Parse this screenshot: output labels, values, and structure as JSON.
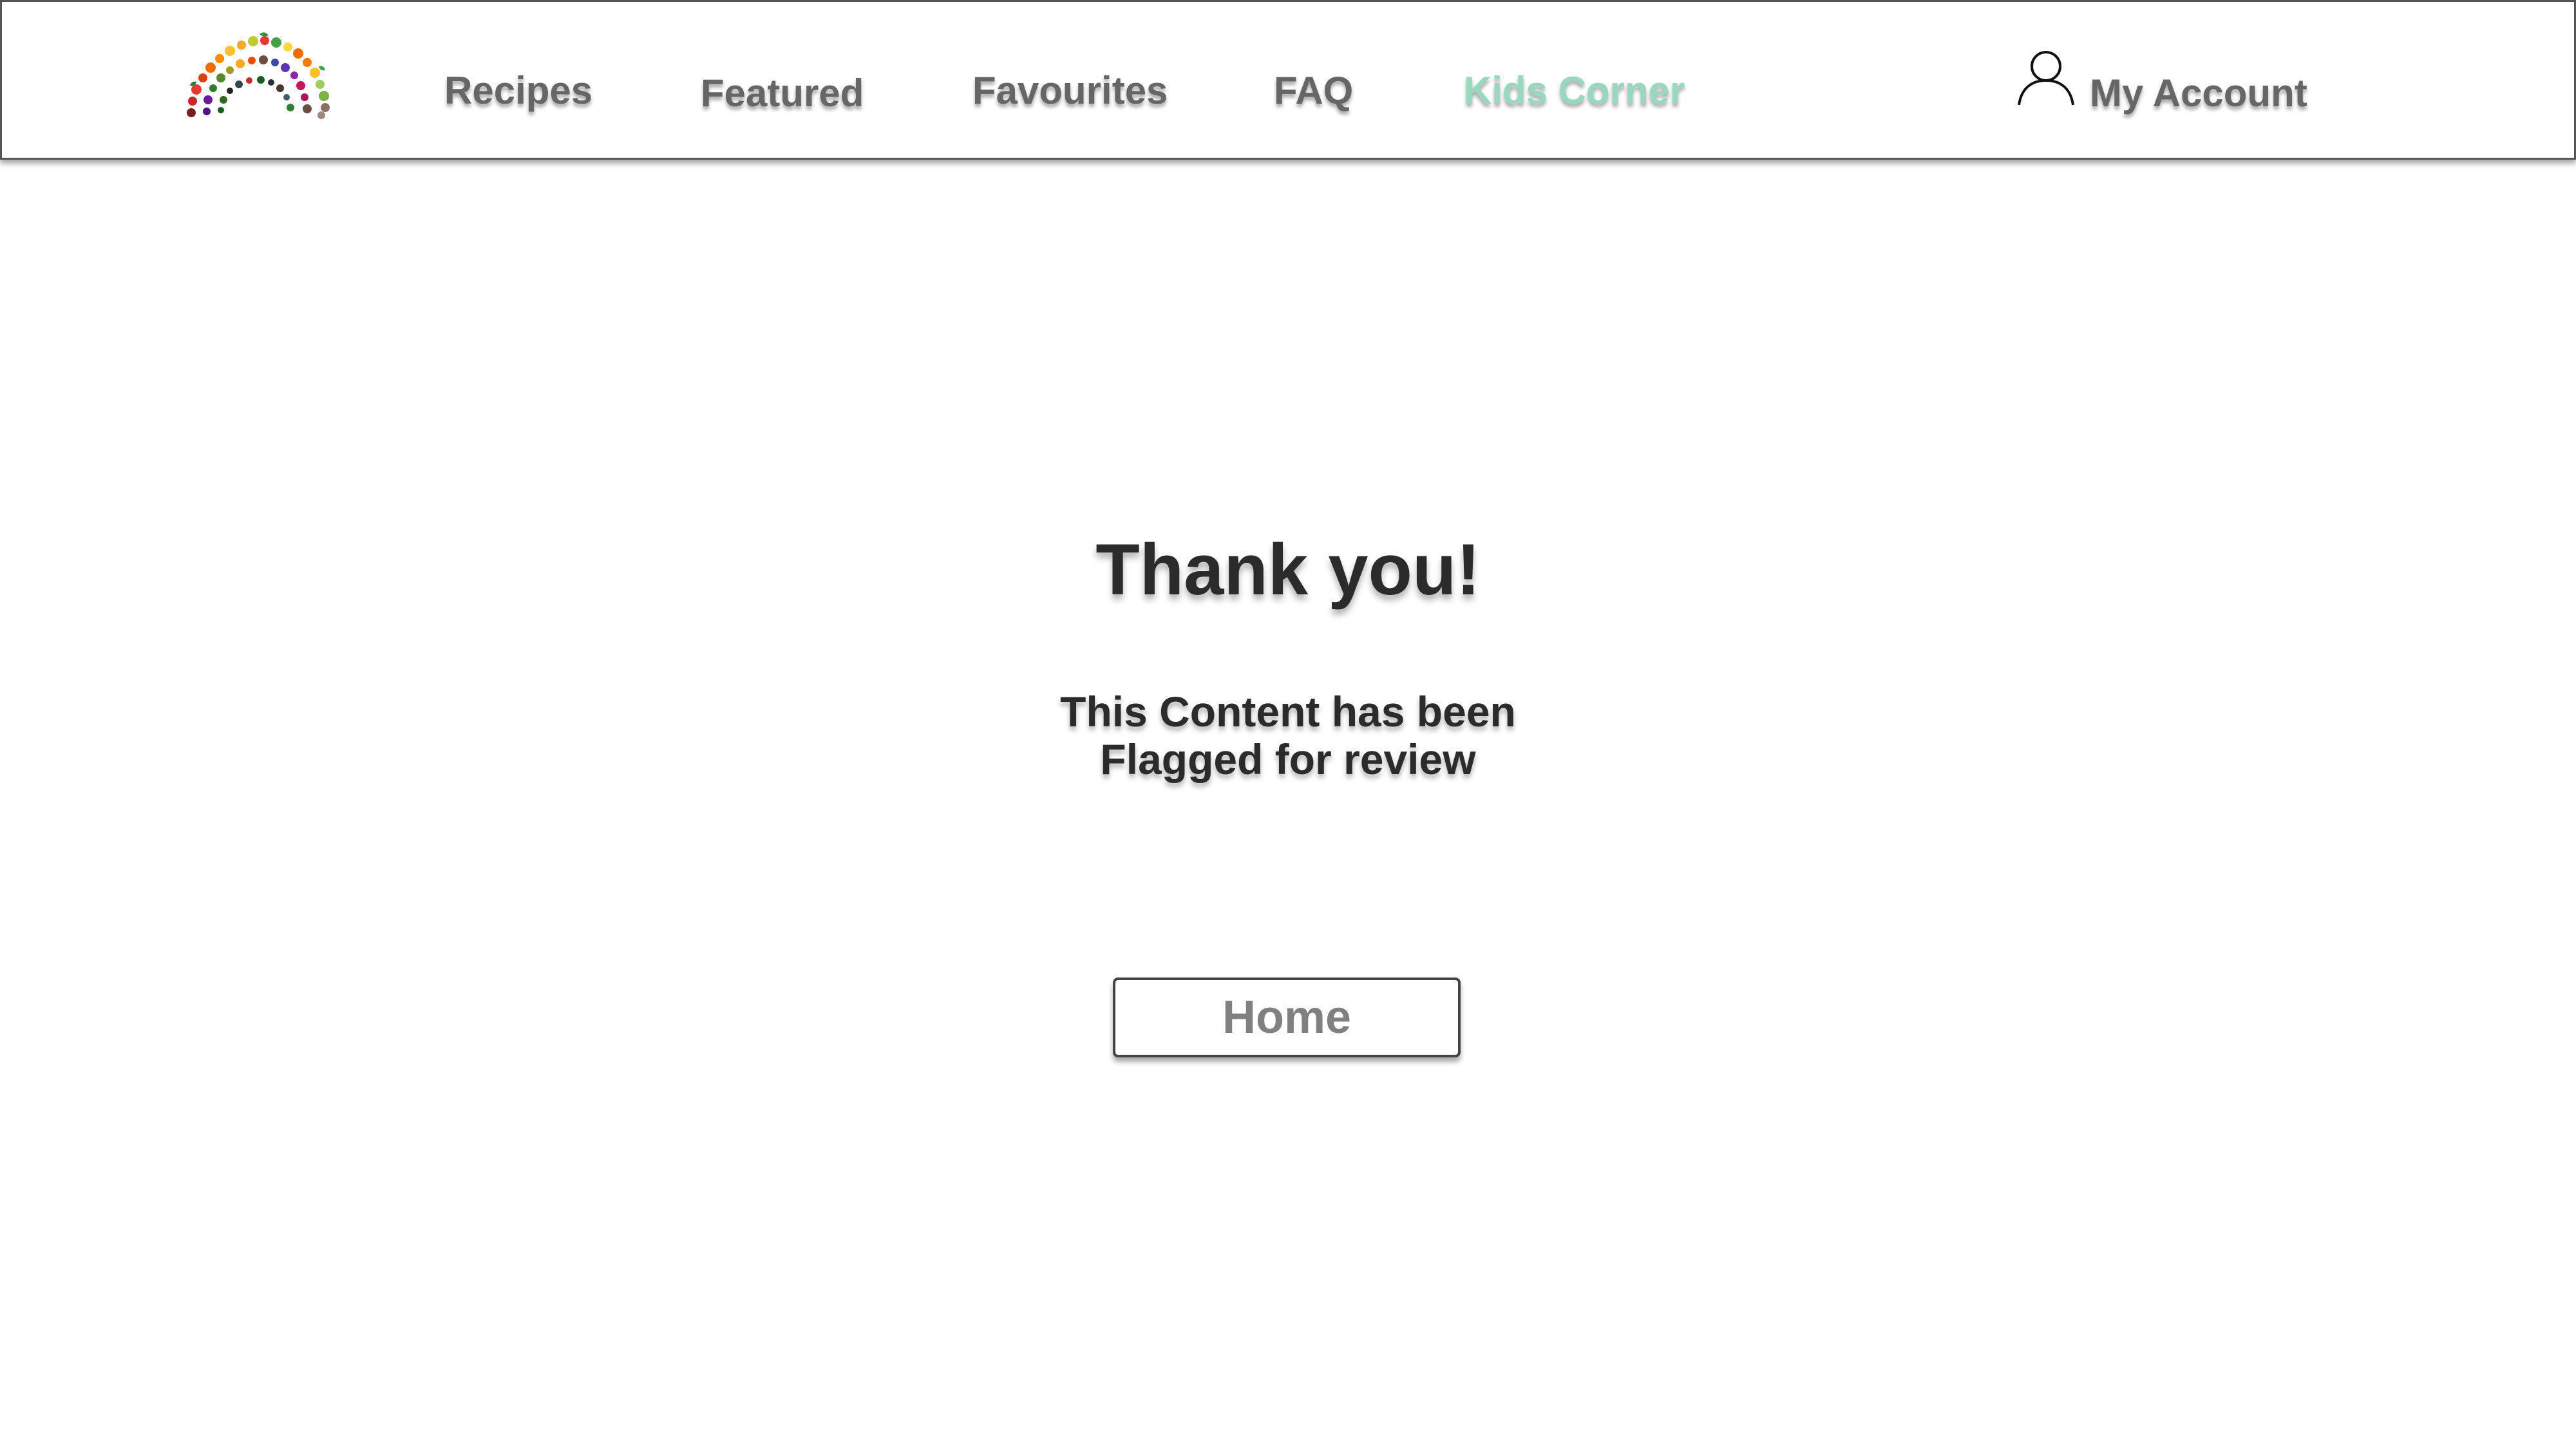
{
  "header": {
    "logo_icon": "fruit-vegetable-rainbow-logo",
    "nav": {
      "recipes": "Recipes",
      "featured": "Featured",
      "favourites": "Favourites",
      "faq": "FAQ",
      "kids_corner": "Kids Corner"
    },
    "account": {
      "icon": "user-icon",
      "label": "My Account"
    }
  },
  "main": {
    "title": "Thank you!",
    "message_lines": [
      "This Content has been",
      "Flagged for review"
    ],
    "home_button": "Home"
  },
  "colors": {
    "nav_text": "#666666",
    "nav_active": "#98d8bf",
    "heading_text": "#2b2b2b",
    "button_text": "#808080",
    "border": "#555555"
  }
}
